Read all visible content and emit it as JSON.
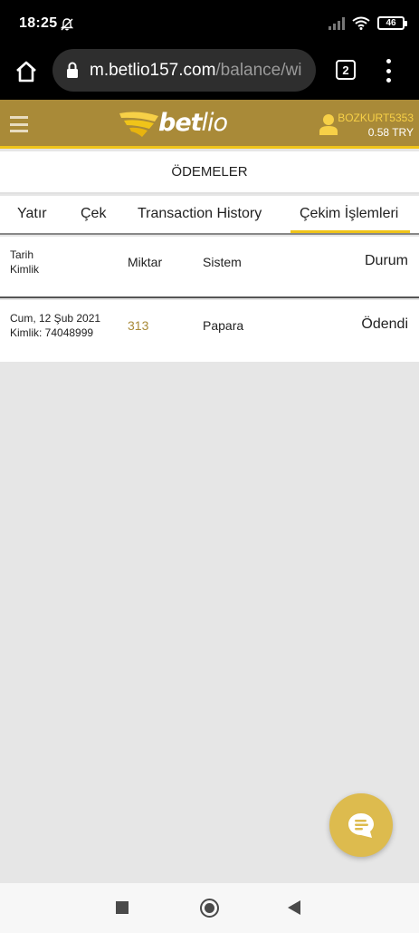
{
  "status_bar": {
    "time": "18:25",
    "battery": "46",
    "icons": [
      "do-not-disturb-icon",
      "signal-icon",
      "wifi-icon",
      "battery-icon"
    ]
  },
  "browser": {
    "url_domain": "m.betlio157.com",
    "url_path": "/balance/wi",
    "tab_count": "2"
  },
  "header": {
    "logo_bold": "bet",
    "logo_thin": "lio",
    "username": "BOZKURT5353",
    "balance": "0.58 TRY",
    "accent_color": "#f0c419",
    "header_color": "#a98a38"
  },
  "page": {
    "title": "ÖDEMELER"
  },
  "tabs": [
    {
      "label": "Yatır"
    },
    {
      "label": "Çek"
    },
    {
      "label": "Transaction History"
    },
    {
      "label": "Çekim İşlemleri",
      "active": true
    }
  ],
  "table": {
    "headers": {
      "date": "Tarih",
      "id": "Kimlik",
      "amount": "Miktar",
      "system": "Sistem",
      "status": "Durum"
    },
    "rows": [
      {
        "date": "Cum, 12 Şub 2021",
        "id": "Kimlik: 74048999",
        "amount": "313",
        "system": "Papara",
        "status": "Ödendi"
      }
    ]
  }
}
